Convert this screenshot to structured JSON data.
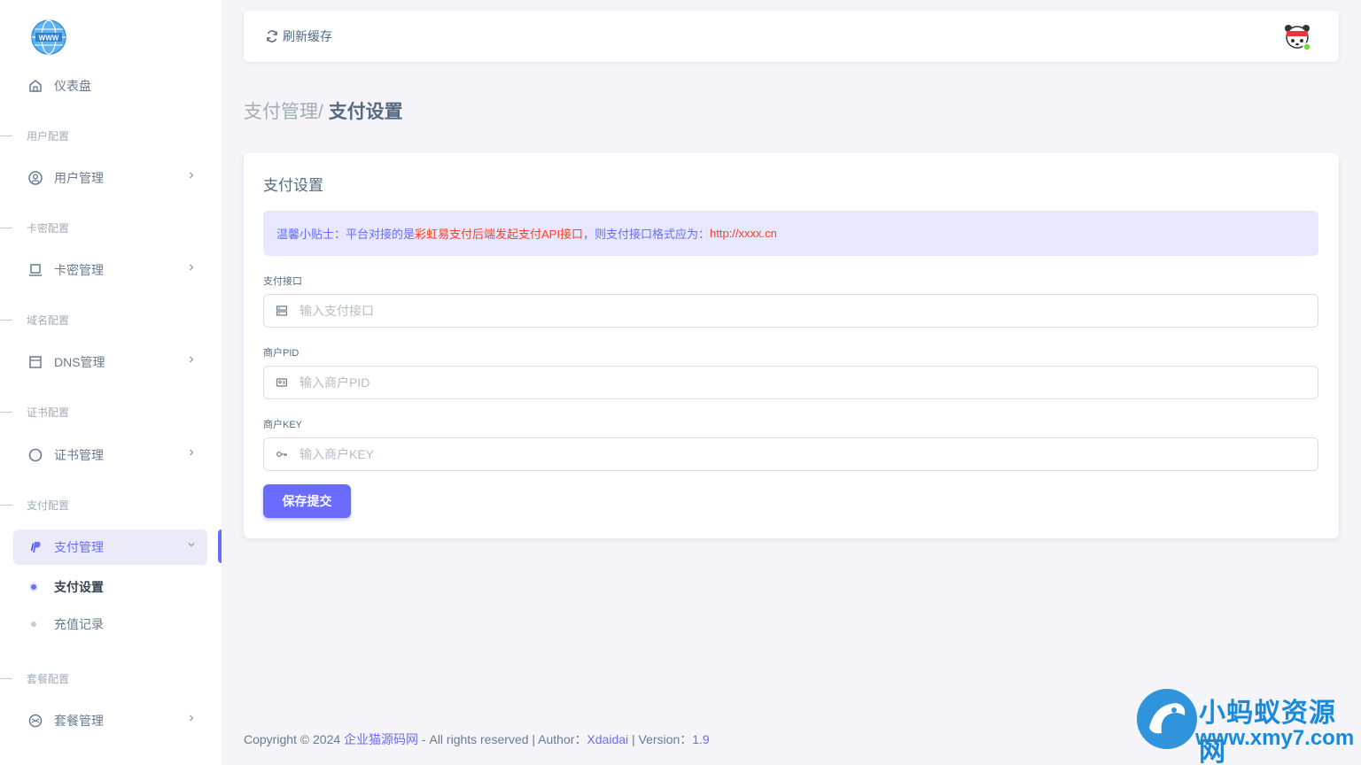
{
  "sidebar": {
    "dashboard": "仪表盘",
    "sections": {
      "user": "用户配置",
      "card": "卡密配置",
      "domain": "域名配置",
      "cert": "证书配置",
      "pay": "支付配置",
      "plan": "套餐配置"
    },
    "items": {
      "user_mgmt": "用户管理",
      "card_mgmt": "卡密管理",
      "dns_mgmt": "DNS管理",
      "cert_mgmt": "证书管理",
      "pay_mgmt": "支付管理",
      "plan_mgmt": "套餐管理"
    },
    "sub_items": {
      "pay_settings": "支付设置",
      "recharge_records": "充值记录"
    }
  },
  "navbar": {
    "refresh_label": "刷新缓存"
  },
  "breadcrumb": {
    "parent": "支付管理/",
    "current": "支付设置"
  },
  "card": {
    "title": "支付设置",
    "alert": {
      "prefix": "温馨小贴士：平台对接的是",
      "highlight": "彩虹易支付后端发起支付API接口",
      "middle": "，则支付接口格式应为：",
      "url": "http://xxxx.cn"
    },
    "fields": {
      "api": {
        "label": "支付接口",
        "placeholder": "输入支付接口",
        "value": ""
      },
      "pid": {
        "label": "商户PID",
        "placeholder": "输入商户PID",
        "value": ""
      },
      "key": {
        "label": "商户KEY",
        "placeholder": "输入商户KEY",
        "value": ""
      }
    },
    "submit_label": "保存提交"
  },
  "footer": {
    "copyright": "Copyright © 2024 ",
    "site": "企业猫源码网",
    "rights": " - All rights reserved | Author：",
    "author": "Xdaidai",
    "version_label": " | Version：",
    "version": "1.9"
  },
  "watermark": {
    "line1": "小蚂蚁资源网",
    "line2": "www.xmy7.com"
  },
  "colors": {
    "primary": "#696cff",
    "alert_bg": "#e7e7ff",
    "highlight_red": "#ff3e1d",
    "background": "#f5f5f9"
  }
}
